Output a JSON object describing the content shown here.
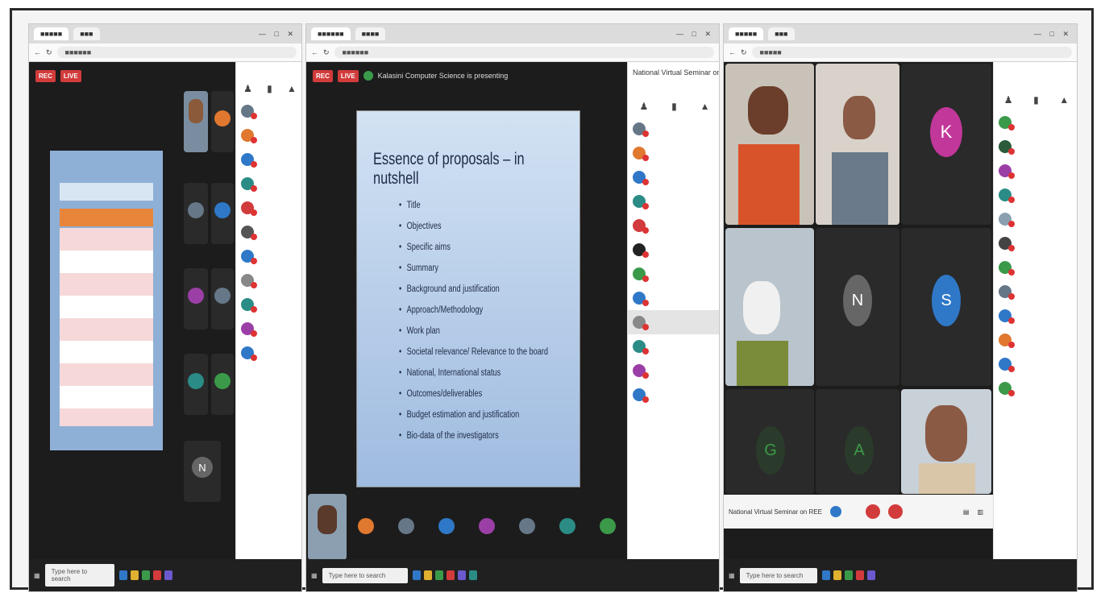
{
  "screen2": {
    "title": "Kalasini Computer Science is presenting",
    "side_title": "National Virtual Seminar on REE",
    "slide": {
      "title": "Essence of proposals – in nutshell",
      "bullets": [
        "Title",
        "Objectives",
        "Specific aims",
        "Summary",
        "Background and justification",
        "Approach/Methodology",
        "Work plan",
        "Societal relevance/ Relevance to the board",
        "National, International status",
        "Outcomes/deliverables",
        "Budget estimation and justification",
        "Bio-data of the investigators"
      ]
    },
    "search_placeholder": "Type here to search"
  },
  "screen3": {
    "initials": [
      "K",
      "N",
      "S",
      "G",
      "A"
    ],
    "footer_label": "National Virtual Seminar on REE",
    "search_placeholder": "Type here to search"
  },
  "screen1": {
    "search_placeholder": "Type here to search",
    "initial": "N"
  },
  "badges": {
    "rec": "REC",
    "live": "LIVE"
  },
  "colors": {
    "orange": "#e0782f",
    "blue": "#2f78c8",
    "green": "#3b9a4a",
    "purple": "#9b3fa6",
    "magenta": "#c2379a",
    "grey": "#667788",
    "teal": "#2b8c86"
  }
}
